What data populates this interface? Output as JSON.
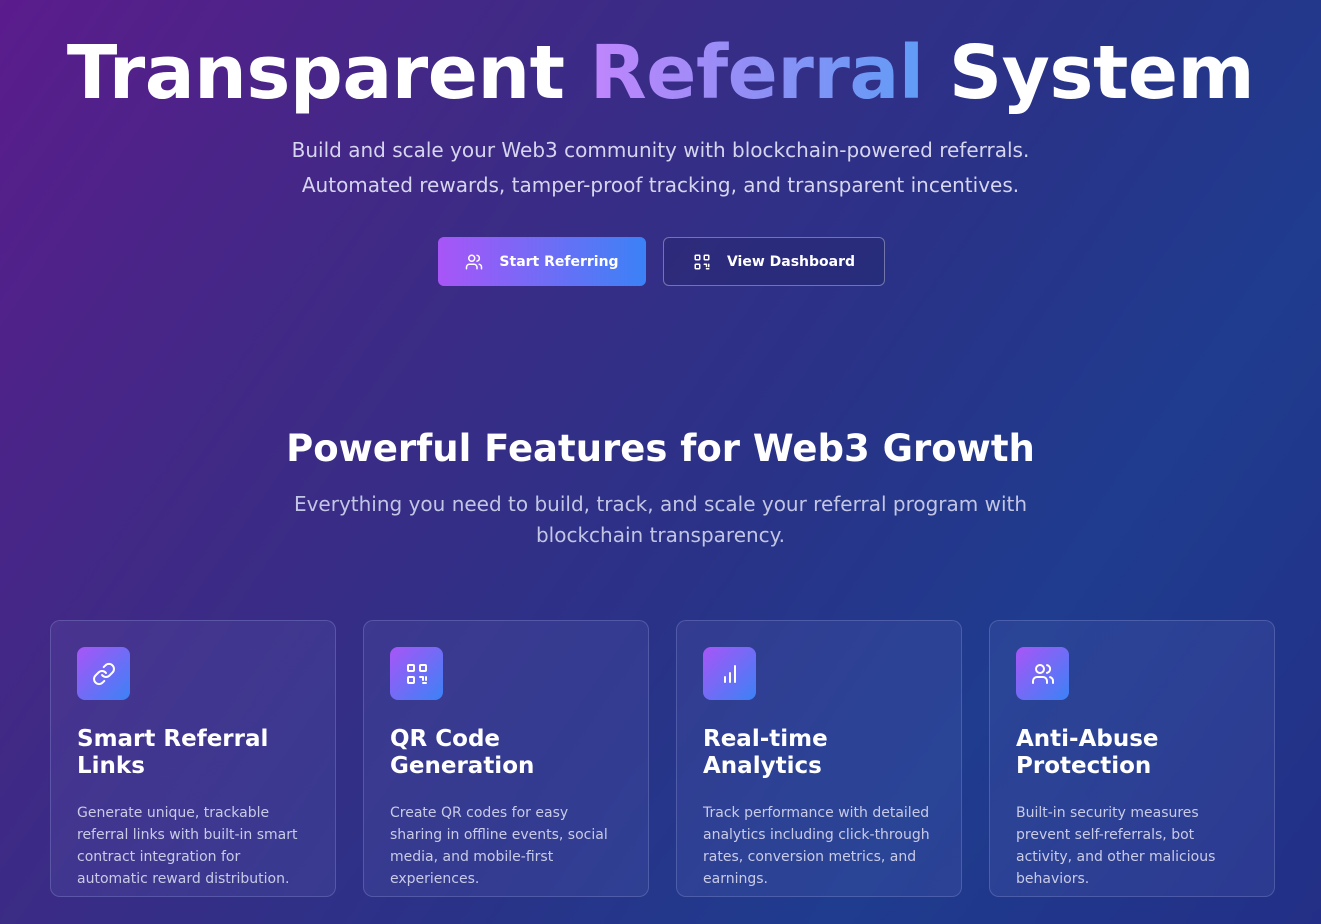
{
  "hero": {
    "title_part1": "Transparent ",
    "title_highlight": "Referral",
    "title_part2": " System",
    "subtitle_line1": "Build and scale your Web3 community with blockchain-powered referrals.",
    "subtitle_line2": "Automated rewards, tamper-proof tracking, and transparent incentives.",
    "primary_button": {
      "label": "Start Referring",
      "icon": "users-icon"
    },
    "secondary_button": {
      "label": "View Dashboard",
      "icon": "qr-code-icon"
    }
  },
  "features": {
    "title": "Powerful Features for Web3 Growth",
    "subtitle_line1": "Everything you need to build, track, and scale your referral program with",
    "subtitle_line2": "blockchain transparency.",
    "cards": [
      {
        "icon": "link-icon",
        "title": "Smart Referral Links",
        "description": "Generate unique, trackable referral links with built-in smart contract integration for automatic reward distribution."
      },
      {
        "icon": "qr-code-icon",
        "title": "QR Code Generation",
        "description": "Create QR codes for easy sharing in offline events, social media, and mobile-first experiences."
      },
      {
        "icon": "bar-chart-icon",
        "title": "Real-time Analytics",
        "description": "Track performance with detailed analytics including click-through rates, conversion metrics, and earnings."
      },
      {
        "icon": "users-icon",
        "title": "Anti-Abuse Protection",
        "description": "Built-in security measures prevent self-referrals, bot activity, and other malicious behaviors."
      }
    ]
  },
  "colors": {
    "accent_start": "#a855f7",
    "accent_end": "#3b82f6",
    "background_start": "#5b1c8c",
    "background_end": "#1f3c8e"
  }
}
